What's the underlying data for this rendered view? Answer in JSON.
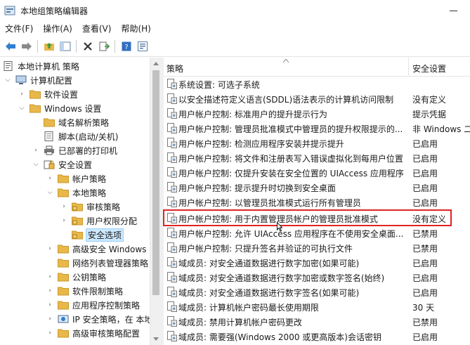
{
  "window": {
    "title": "本地组策略编辑器"
  },
  "menu": [
    {
      "label": "文件(F)"
    },
    {
      "label": "操作(A)"
    },
    {
      "label": "查看(V)"
    },
    {
      "label": "帮助(H)"
    }
  ],
  "tree": {
    "items": [
      {
        "label": "本地计算机 策略",
        "icon": "computer-policy-icon",
        "toggle": "",
        "expanded": true,
        "selected": false
      },
      {
        "label": "计算机配置",
        "icon": "computer-icon",
        "toggle": "v",
        "expanded": true,
        "selected": false
      },
      {
        "label": "软件设置",
        "icon": "folder-icon",
        "toggle": ">",
        "expanded": false,
        "selected": false
      },
      {
        "label": "Windows 设置",
        "icon": "folder-icon",
        "toggle": "v",
        "expanded": true,
        "selected": false
      },
      {
        "label": "域名解析策略",
        "icon": "folder-icon",
        "toggle": "",
        "expanded": false,
        "selected": false
      },
      {
        "label": "脚本(启动/关机)",
        "icon": "script-icon",
        "toggle": "",
        "expanded": false,
        "selected": false
      },
      {
        "label": "已部署的打印机",
        "icon": "printer-icon",
        "toggle": ">",
        "expanded": false,
        "selected": false
      },
      {
        "label": "安全设置",
        "icon": "security-icon",
        "toggle": "v",
        "expanded": true,
        "selected": false
      },
      {
        "label": "帐户策略",
        "icon": "folder-icon",
        "toggle": ">",
        "expanded": false,
        "selected": false
      },
      {
        "label": "本地策略",
        "icon": "folder-icon",
        "toggle": "v",
        "expanded": true,
        "selected": false
      },
      {
        "label": "审核策略",
        "icon": "folder-lock-icon",
        "toggle": ">",
        "expanded": false,
        "selected": false
      },
      {
        "label": "用户权限分配",
        "icon": "folder-lock-icon",
        "toggle": ">",
        "expanded": false,
        "selected": false
      },
      {
        "label": "安全选项",
        "icon": "folder-lock-icon",
        "toggle": "",
        "expanded": false,
        "selected": true
      },
      {
        "label": "高级安全 Windows",
        "icon": "folder-icon",
        "toggle": ">",
        "expanded": false,
        "selected": false
      },
      {
        "label": "网络列表管理器策略",
        "icon": "folder-icon",
        "toggle": "",
        "expanded": false,
        "selected": false
      },
      {
        "label": "公钥策略",
        "icon": "folder-icon",
        "toggle": ">",
        "expanded": false,
        "selected": false
      },
      {
        "label": "软件限制策略",
        "icon": "folder-icon",
        "toggle": ">",
        "expanded": false,
        "selected": false
      },
      {
        "label": "应用程序控制策略",
        "icon": "folder-icon",
        "toggle": ">",
        "expanded": false,
        "selected": false
      },
      {
        "label": "IP 安全策略，在 本地",
        "icon": "ip-security-icon",
        "toggle": ">",
        "expanded": false,
        "selected": false
      },
      {
        "label": "高级审核策略配置",
        "icon": "folder-icon",
        "toggle": ">",
        "expanded": false,
        "selected": false
      }
    ]
  },
  "list": {
    "header_policy": "策略",
    "header_setting": "安全设置",
    "rows": [
      {
        "name": "系统设置: 可选子系统",
        "setting": ""
      },
      {
        "name": "以安全描述符定义语言(SDDL)语法表示的计算机访问限制",
        "setting": "没有定义"
      },
      {
        "name": "用户帐户控制: 标准用户的提升提示行为",
        "setting": "提示凭据"
      },
      {
        "name": "用户帐户控制: 管理员批准模式中管理员的提升权限提示的...",
        "setting": "非 Windows 二"
      },
      {
        "name": "用户帐户控制: 检测应用程序安装并提示提升",
        "setting": "已启用"
      },
      {
        "name": "用户帐户控制: 将文件和注册表写入错误虚拟化到每用户位置",
        "setting": "已启用"
      },
      {
        "name": "用户帐户控制: 仅提升安装在安全位置的 UIAccess 应用程序",
        "setting": "已启用"
      },
      {
        "name": "用户帐户控制: 提示提升时切换到安全桌面",
        "setting": "已启用"
      },
      {
        "name": "用户帐户控制: 以管理员批准模式运行所有管理员",
        "setting": "已启用"
      },
      {
        "name": "用户帐户控制: 用于内置管理员帐户的管理员批准模式",
        "setting": "没有定义"
      },
      {
        "name": "用户帐户控制: 允许 UIAccess 应用程序在不使用安全桌面...",
        "setting": "已禁用"
      },
      {
        "name": "用户帐户控制: 只提升签名并验证的可执行文件",
        "setting": "已禁用"
      },
      {
        "name": "域成员: 对安全通道数据进行数字加密(如果可能)",
        "setting": "已启用"
      },
      {
        "name": "域成员: 对安全通道数据进行数字加密或数字签名(始终)",
        "setting": "已启用"
      },
      {
        "name": "域成员: 对安全通道数据进行数字签名(如果可能)",
        "setting": "已启用"
      },
      {
        "name": "域成员: 计算机帐户密码最长使用期限",
        "setting": "30 天"
      },
      {
        "name": "域成员: 禁用计算机帐户密码更改",
        "setting": "已禁用"
      },
      {
        "name": "域成员: 需要强(Windows 2000 或更高版本)会话密钥",
        "setting": "已启用"
      }
    ]
  },
  "colors": {
    "highlight_border": "#e02424",
    "selection_bg": "#cce8ff",
    "folder": "#e8b84a"
  }
}
